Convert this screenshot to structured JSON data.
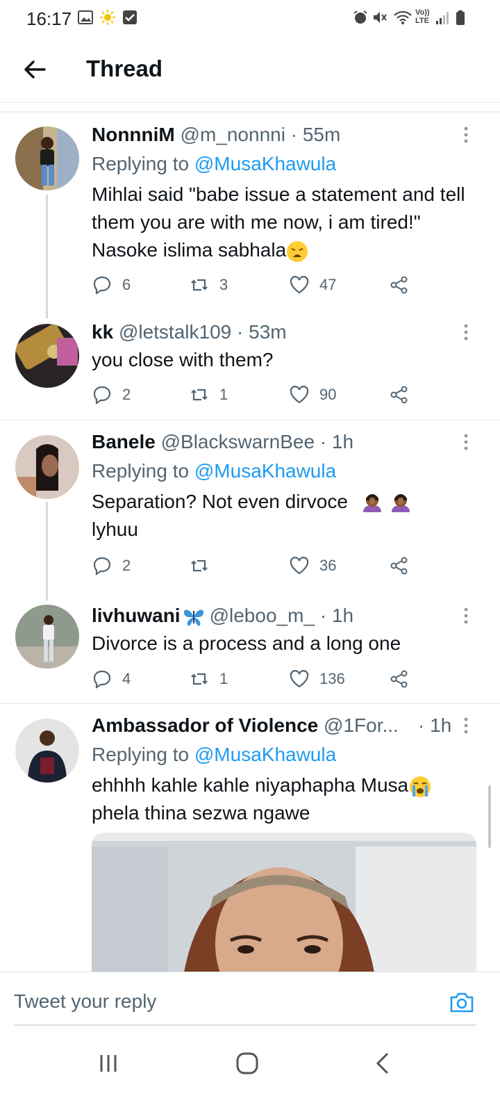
{
  "status_bar": {
    "time": "16:17",
    "network": "Vo)) LTE"
  },
  "header": {
    "title": "Thread",
    "back_icon": "arrow-left-icon"
  },
  "colors": {
    "accent": "#1d9bf0",
    "muted": "#536471",
    "text": "#0f1419"
  },
  "tweets": [
    {
      "display_name": "NonnniM",
      "handle": "@m_nonnni",
      "time": "· 55m",
      "replying_label": "Replying to",
      "replying_to": "@MusaKhawula",
      "text": "Mihlai said \"babe issue a statement and tell them you are with me now, i am tired!\" Nasoke islima sabhala",
      "text_emoji": "weary-face",
      "replies": "6",
      "retweets": "3",
      "likes": "47"
    },
    {
      "display_name": "kk",
      "handle": "@letstalk109",
      "time": "· 53m",
      "text": "you close with them?",
      "replies": "2",
      "retweets": "1",
      "likes": "90"
    },
    {
      "display_name": "Banele",
      "handle": "@BlackswarnBee",
      "time": "· 1h",
      "replying_label": "Replying to",
      "replying_to": "@MusaKhawula",
      "text": "Separation? Not even dirvoce",
      "text_line2": "lyhuu",
      "text_emoji": "woman-facepalming x2",
      "replies": "2",
      "retweets": "",
      "likes": "36"
    },
    {
      "display_name": "livhuwani",
      "name_emoji": "butterfly",
      "handle": "@leboo_m_",
      "time": "· 1h",
      "text": "Divorce is a process and a long one",
      "replies": "4",
      "retweets": "1",
      "likes": "136"
    },
    {
      "display_name": "Ambassador of Violence",
      "handle": "@1For...",
      "time": "· 1h",
      "replying_label": "Replying to",
      "replying_to": "@MusaKhawula",
      "text": "ehhhh kahle kahle niyaphapha Musa",
      "text_line2": "phela thina sezwa ngawe",
      "text_emoji": "loudly-crying-face"
    }
  ],
  "reply_bar": {
    "placeholder": "Tweet your reply",
    "icon": "camera-icon"
  },
  "nav_bar": {
    "recents": "recents-icon",
    "home": "home-icon",
    "back": "back-icon"
  }
}
